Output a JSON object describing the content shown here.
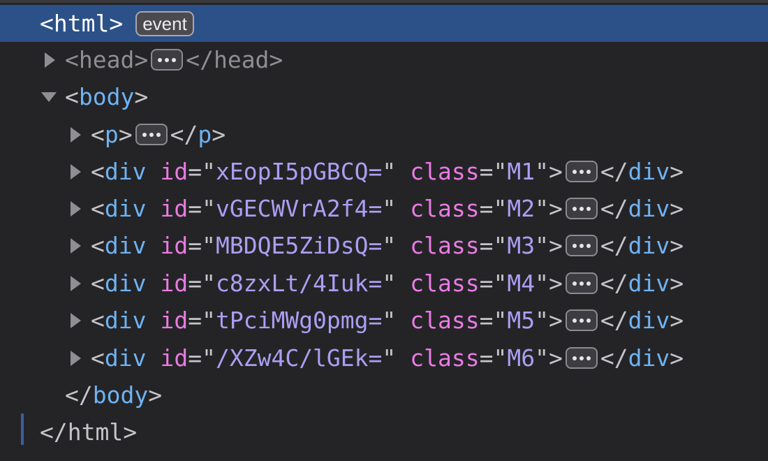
{
  "html_node": {
    "open": "<html>",
    "badge": "event",
    "close": "</html>"
  },
  "head_node": {
    "open": "<head>",
    "close": "</head>",
    "collapsed": true
  },
  "body_node": {
    "open_tag": "body",
    "close_tag": "body",
    "expanded": true
  },
  "p_node": {
    "tag": "p",
    "collapsed": true
  },
  "div_nodes": [
    {
      "tag": "div",
      "id_attr": "id",
      "id_value": "xEopI5pGBCQ=",
      "class_attr": "class",
      "class_value": "M1"
    },
    {
      "tag": "div",
      "id_attr": "id",
      "id_value": "vGECWVrA2f4=",
      "class_attr": "class",
      "class_value": "M2"
    },
    {
      "tag": "div",
      "id_attr": "id",
      "id_value": "MBDQE5ZiDsQ=",
      "class_attr": "class",
      "class_value": "M3"
    },
    {
      "tag": "div",
      "id_attr": "id",
      "id_value": "c8zxLt/4Iuk=",
      "class_attr": "class",
      "class_value": "M4"
    },
    {
      "tag": "div",
      "id_attr": "id",
      "id_value": "tPciMWg0pmg=",
      "class_attr": "class",
      "class_value": "M5"
    },
    {
      "tag": "div",
      "id_attr": "id",
      "id_value": "/XZw4C/lGEk=",
      "class_attr": "class",
      "class_value": "M6"
    }
  ],
  "colors": {
    "background": "#242427",
    "selection": "#2c5088",
    "tag_name": "#6fb3f2",
    "attribute_name": "#ea7be3",
    "attribute_value": "#ab9ff2",
    "punctuation": "#c5c5c9"
  }
}
